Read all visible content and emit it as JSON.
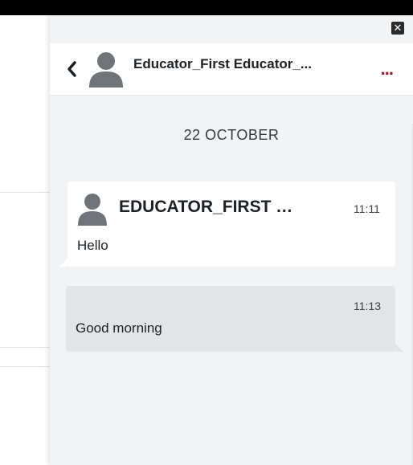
{
  "header": {
    "contact_name": "Educator_First Educator_...",
    "more_label": "..."
  },
  "conversation": {
    "date_separator": "22 OCTOBER",
    "messages": [
      {
        "direction": "received",
        "sender": "EDUCATOR_FIRST ED...",
        "time": "11:11",
        "text": "Hello"
      },
      {
        "direction": "sent",
        "time": "11:13",
        "text": "Good morning"
      }
    ]
  },
  "icons": {
    "close": "close-icon",
    "back": "chevron-left-icon",
    "avatar": "user-avatar-icon",
    "more": "more-dots-icon"
  },
  "colors": {
    "top_bar": "#000000",
    "drawer_bg": "#f2f3f4",
    "more_dots": "#8f1b2f",
    "sent_bubble": "#e2e4e8",
    "received_bubble": "#ffffff",
    "avatar": "#6f7479"
  }
}
